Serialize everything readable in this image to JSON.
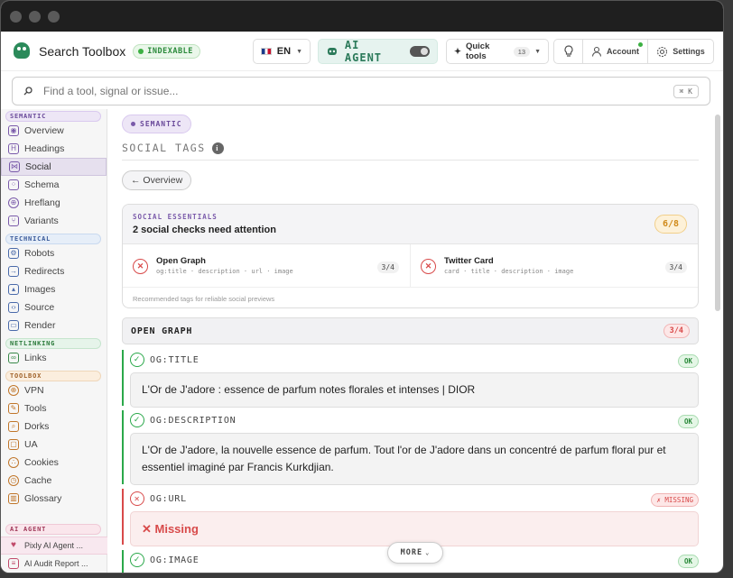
{
  "header": {
    "brand": "Search Toolbox",
    "index_badge": "INDEXABLE",
    "lang": "EN",
    "ai_agent": "AI AGENT",
    "quick_tools": "Quick tools",
    "quick_tools_count": "13",
    "account": "Account",
    "settings": "Settings"
  },
  "search": {
    "placeholder": "Find a tool, signal or issue...",
    "shortcut": "⌘ K"
  },
  "sidebar": {
    "semantic": "SEMANTIC",
    "semantic_items": [
      "Overview",
      "Headings",
      "Social",
      "Schema",
      "Hreflang",
      "Variants"
    ],
    "technical": "TECHNICAL",
    "technical_items": [
      "Robots",
      "Redirects",
      "Images",
      "Source",
      "Render"
    ],
    "netlinking": "NETLINKING",
    "netlinking_items": [
      "Links"
    ],
    "toolbox": "TOOLBOX",
    "toolbox_items": [
      "VPN",
      "Tools",
      "Dorks",
      "UA",
      "Cookies",
      "Cache",
      "Glossary"
    ],
    "ai_agent": "AI AGENT",
    "ai_items": [
      "Pixly AI Agent ...",
      "AI Audit Report ..."
    ]
  },
  "main": {
    "section_pill": "SEMANTIC",
    "title": "SOCIAL TAGS",
    "back": "← Overview",
    "essentials": {
      "label": "SOCIAL ESSENTIALS",
      "title": "2 social checks need attention",
      "score": "6/8",
      "og_title": "Open Graph",
      "og_tags": "og:title · description · url · image",
      "og_count": "3/4",
      "tw_title": "Twitter Card",
      "tw_tags": "card · title · description · image",
      "tw_count": "3/4",
      "footer": "Recommended tags for reliable social previews"
    },
    "og_section": {
      "title": "OPEN GRAPH",
      "count": "3/4"
    },
    "fields": [
      {
        "name": "OG:TITLE",
        "status": "OK",
        "value": "L'Or de J'adore : essence de parfum notes florales et intenses | DIOR"
      },
      {
        "name": "OG:DESCRIPTION",
        "status": "OK",
        "value": "L'Or de J'adore, la nouvelle essence de parfum. Tout l'or de J'adore dans un concentré de parfum floral pur et essentiel imaginé par Francis Kurkdjian."
      },
      {
        "name": "OG:URL",
        "status": "✗ MISSING",
        "value": "✕ Missing"
      },
      {
        "name": "OG:IMAGE",
        "status": "OK"
      }
    ],
    "more": "MORE"
  }
}
